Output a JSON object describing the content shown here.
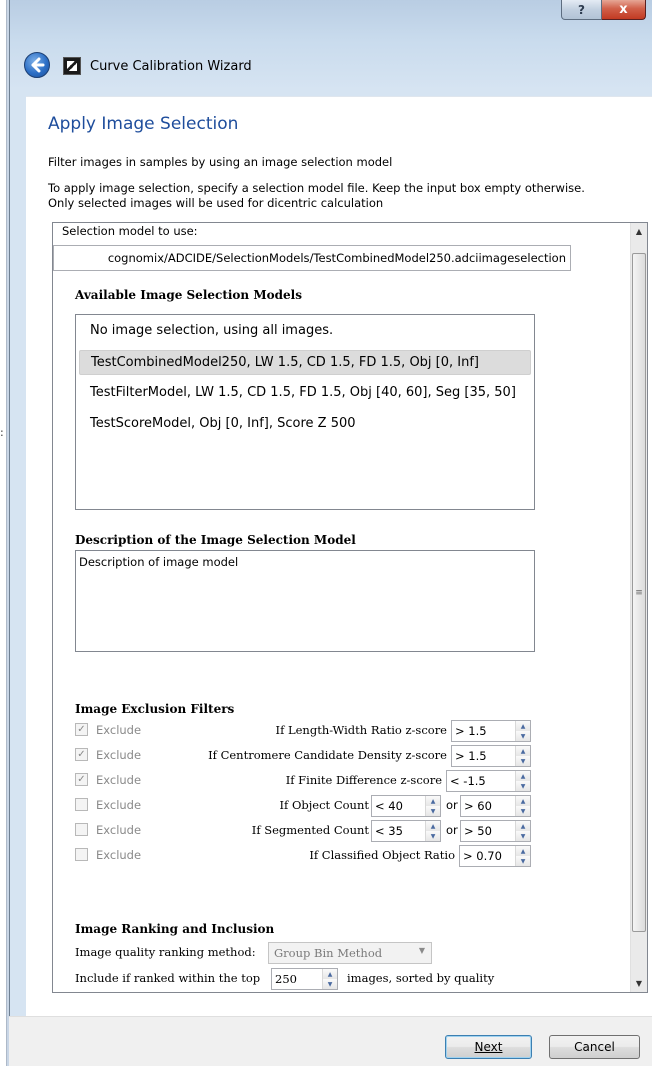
{
  "window": {
    "title": "Curve Calibration Wizard",
    "help_label": "?",
    "close_label": "x",
    "stray_text": ":"
  },
  "page": {
    "title": "Apply Image Selection",
    "intro_line1": "Filter images in samples by using an image selection model",
    "intro_line2": "To apply image selection, specify a selection model file. Keep the input box empty otherwise.",
    "intro_line3": "Only selected images will be used for dicentric calculation"
  },
  "selection_model": {
    "label": "Selection model to use:",
    "value": "cognomix/ADCIDE/SelectionModels/TestCombinedModel250.adciimageselection"
  },
  "available_models": {
    "heading": "Available Image Selection Models",
    "items": [
      {
        "label": "No image selection, using all images.",
        "selected": false
      },
      {
        "label": "TestCombinedModel250, LW 1.5, CD 1.5, FD 1.5, Obj [0, Inf]",
        "selected": true
      },
      {
        "label": "TestFilterModel, LW 1.5, CD 1.5, FD 1.5, Obj [40, 60], Seg [35, 50]",
        "selected": false
      },
      {
        "label": "TestScoreModel, Obj [0, Inf], Score Z 500",
        "selected": false
      }
    ]
  },
  "description": {
    "heading": "Description of the Image Selection Model",
    "text": "Description of image model"
  },
  "exclusion_filters": {
    "heading": "Image Exclusion Filters",
    "exclude_label": "Exclude",
    "or_label": "or",
    "rows": [
      {
        "checked": true,
        "label": "If Length-Width Ratio z-score",
        "value": "> 1.5"
      },
      {
        "checked": true,
        "label": "If Centromere Candidate Density z-score",
        "value": "> 1.5"
      },
      {
        "checked": true,
        "label": "If Finite Difference z-score",
        "value": "< -1.5"
      },
      {
        "checked": false,
        "label": "If Object Count",
        "value": "< 40",
        "value2": "> 60"
      },
      {
        "checked": false,
        "label": "If Segmented Count",
        "value": "< 35",
        "value2": "> 50"
      },
      {
        "checked": false,
        "label": "If Classified Object Ratio",
        "value": "> 0.70"
      }
    ]
  },
  "ranking": {
    "heading": "Image Ranking and Inclusion",
    "method_label": "Image quality ranking method:",
    "method_value": "Group Bin Method",
    "include_prefix": "Include if ranked within the top",
    "top_value": "250",
    "include_suffix": "images, sorted by quality"
  },
  "buttons": {
    "next_label": "Next",
    "cancel_label": "Cancel"
  },
  "colors": {
    "title_blue": "#1e4d9c",
    "close_red": "#c23a22"
  }
}
